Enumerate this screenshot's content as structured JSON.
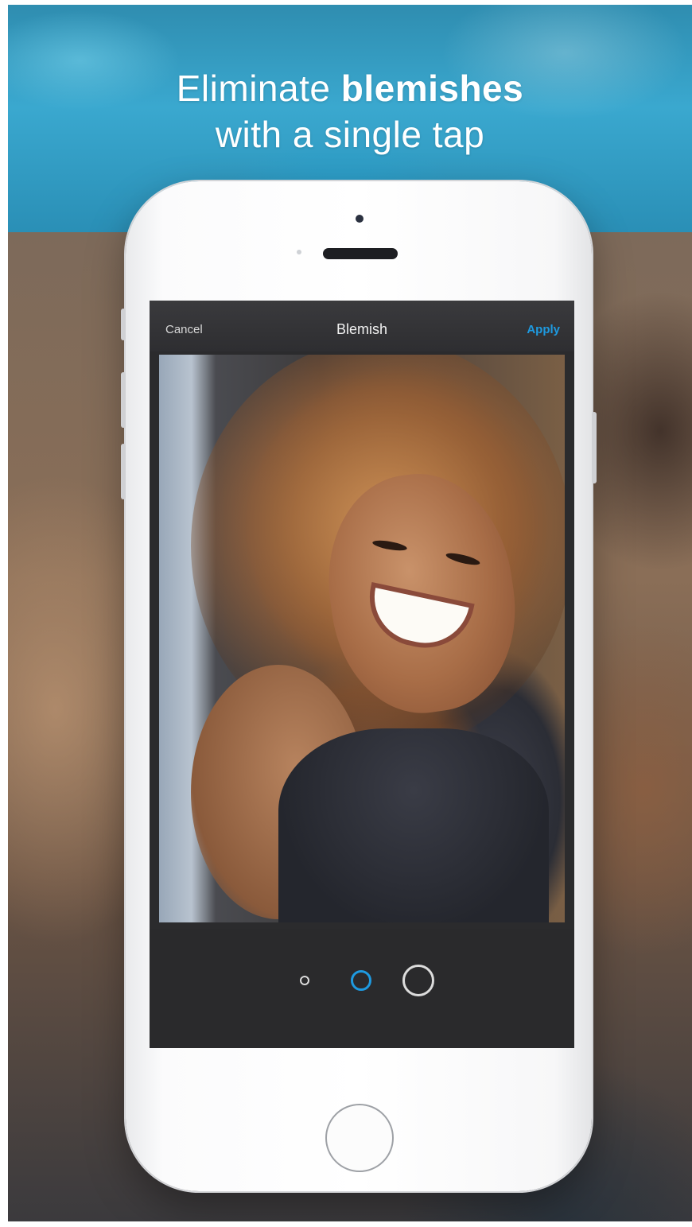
{
  "headline": {
    "line1_regular": "Eliminate",
    "line1_bold": "blemishes",
    "line2": "with a single tap"
  },
  "navbar": {
    "cancel_label": "Cancel",
    "title": "Blemish",
    "apply_label": "Apply"
  },
  "brush_sizes": {
    "options": [
      "small",
      "medium",
      "large"
    ],
    "selected": "medium"
  },
  "colors": {
    "accent": "#1e9ae0",
    "screen_bg": "#2b2b2d",
    "banner_top": "#3aa8cf"
  }
}
